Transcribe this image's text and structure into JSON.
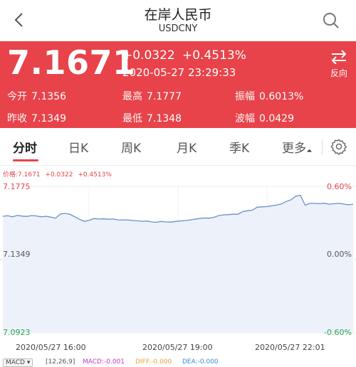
{
  "header": {
    "title": "在岸人民币",
    "subtitle": "USDCNY"
  },
  "quote": {
    "price": "7.1671",
    "change": "+0.0322",
    "change_pct": "+0.4513%",
    "time": "2020-05-27 23:29:33",
    "reverse_label": "反向",
    "stats": [
      {
        "label": "今开",
        "value": "7.1356"
      },
      {
        "label": "最高",
        "value": "7.1777"
      },
      {
        "label": "振幅",
        "value": "0.6013%"
      },
      {
        "label": "昨收",
        "value": "7.1349"
      },
      {
        "label": "最低",
        "value": "7.1348"
      },
      {
        "label": "波幅",
        "value": "0.0429"
      }
    ]
  },
  "tabs": [
    {
      "label": "分时"
    },
    {
      "label": "日K"
    },
    {
      "label": "周K"
    },
    {
      "label": "月K"
    },
    {
      "label": "季K"
    },
    {
      "label": "更多"
    }
  ],
  "chart_info": {
    "price_label": "价格:7.1671",
    "change": "+0.0322",
    "change_pct": "+0.4513%"
  },
  "chart_data": {
    "type": "line",
    "y_axis_left": [
      "7.1775",
      "7.1349",
      "7.0923"
    ],
    "y_axis_right": [
      "0.60%",
      "0.00%",
      "-0.60%"
    ],
    "x_labels": [
      "2020/05/27 16:00",
      "2020/05/27 19:00",
      "2020/05/27 22:01"
    ],
    "ylim": [
      7.0923,
      7.1775
    ],
    "baseline": 7.1349,
    "series": [
      {
        "values": [
          7.1601,
          7.1604,
          7.1598,
          7.1606,
          7.1602,
          7.16,
          7.1605,
          7.1603,
          7.1598,
          7.1601,
          7.1596,
          7.159,
          7.1614,
          7.1618,
          7.1612,
          7.1598,
          7.1583,
          7.1571,
          7.1578,
          7.1588,
          7.1585,
          7.1586,
          7.1584,
          7.1585,
          7.158,
          7.1579,
          7.158,
          7.1576,
          7.1575,
          7.1572,
          7.1573,
          7.1568,
          7.1566,
          7.1571,
          7.1568,
          7.1567,
          7.1571,
          7.1574,
          7.1576,
          7.1579,
          7.1584,
          7.1588,
          7.1591,
          7.159,
          7.1595,
          7.1605,
          7.1609,
          7.1611,
          7.1613,
          7.1613,
          7.1628,
          7.1633,
          7.1637,
          7.1654,
          7.1656,
          7.1657,
          7.1662,
          7.1666,
          7.1672,
          7.1687,
          7.1696,
          7.1717,
          7.1723,
          7.1665,
          7.1676,
          7.1676,
          7.1674,
          7.1677,
          7.1671,
          7.1674,
          7.1676,
          7.1672,
          7.1668,
          7.1671
        ]
      }
    ]
  },
  "indicator": {
    "button": "MACD ▾",
    "params": "[12,26,9]",
    "macd": "MACD:-0.001",
    "diff": "DIFF:-0.000",
    "dea": "DEA:-0.000"
  },
  "colors": {
    "accent": "#e8434a",
    "line": "#6a8fc9",
    "fill": "#edf2fa",
    "down": "#2aa44f"
  }
}
